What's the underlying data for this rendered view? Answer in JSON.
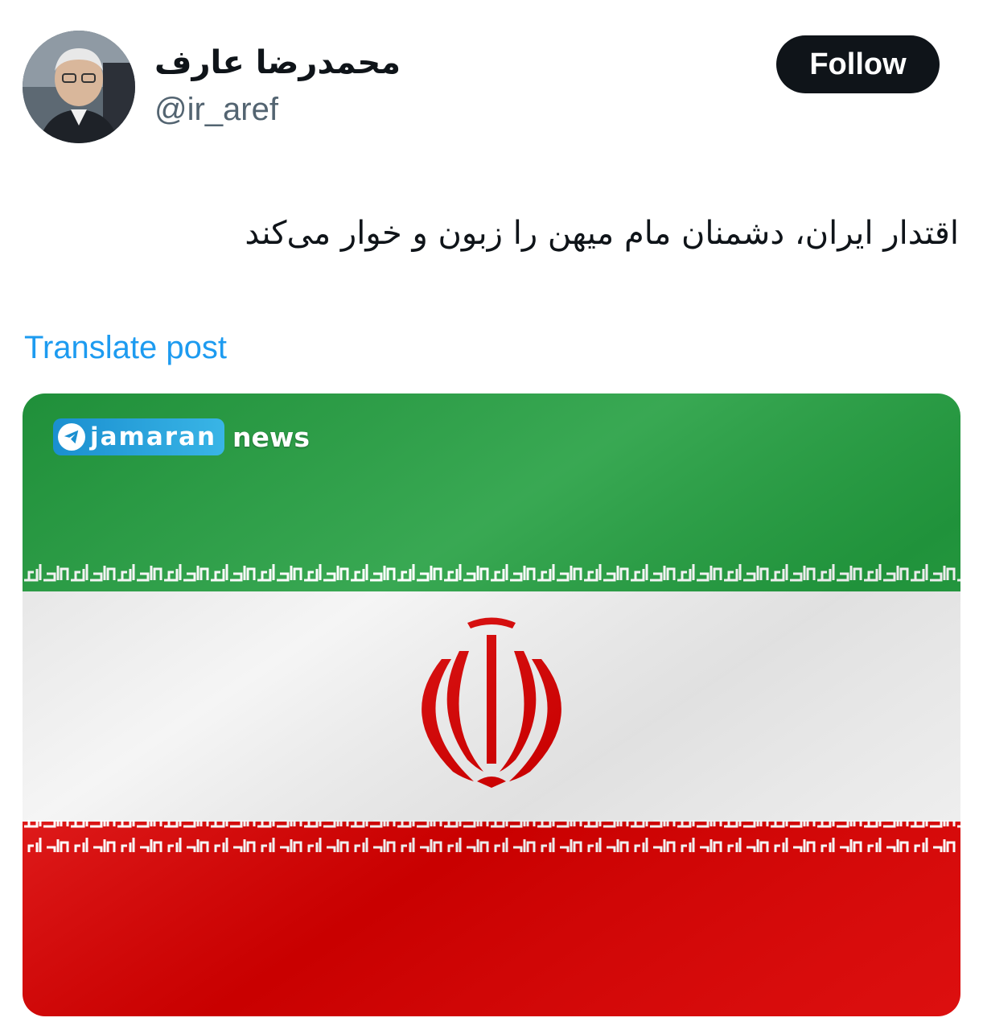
{
  "author": {
    "display_name": "محمدرضا عارف",
    "handle": "@ir_aref",
    "avatar_icon": "user-avatar-photo"
  },
  "follow_button": {
    "label": "Follow"
  },
  "tweet": {
    "text": "اقتدار ایران، دشمنان مام میهن را زبون و خوار می‌کند",
    "translate_label": "Translate post"
  },
  "media": {
    "description_icon": "iran-flag-image",
    "watermark": {
      "brand": "jamaran",
      "suffix": "news",
      "icon": "telegram-plane-icon"
    },
    "colors": {
      "green": "#239f40",
      "white": "#f4f4f4",
      "red": "#da0000"
    }
  }
}
